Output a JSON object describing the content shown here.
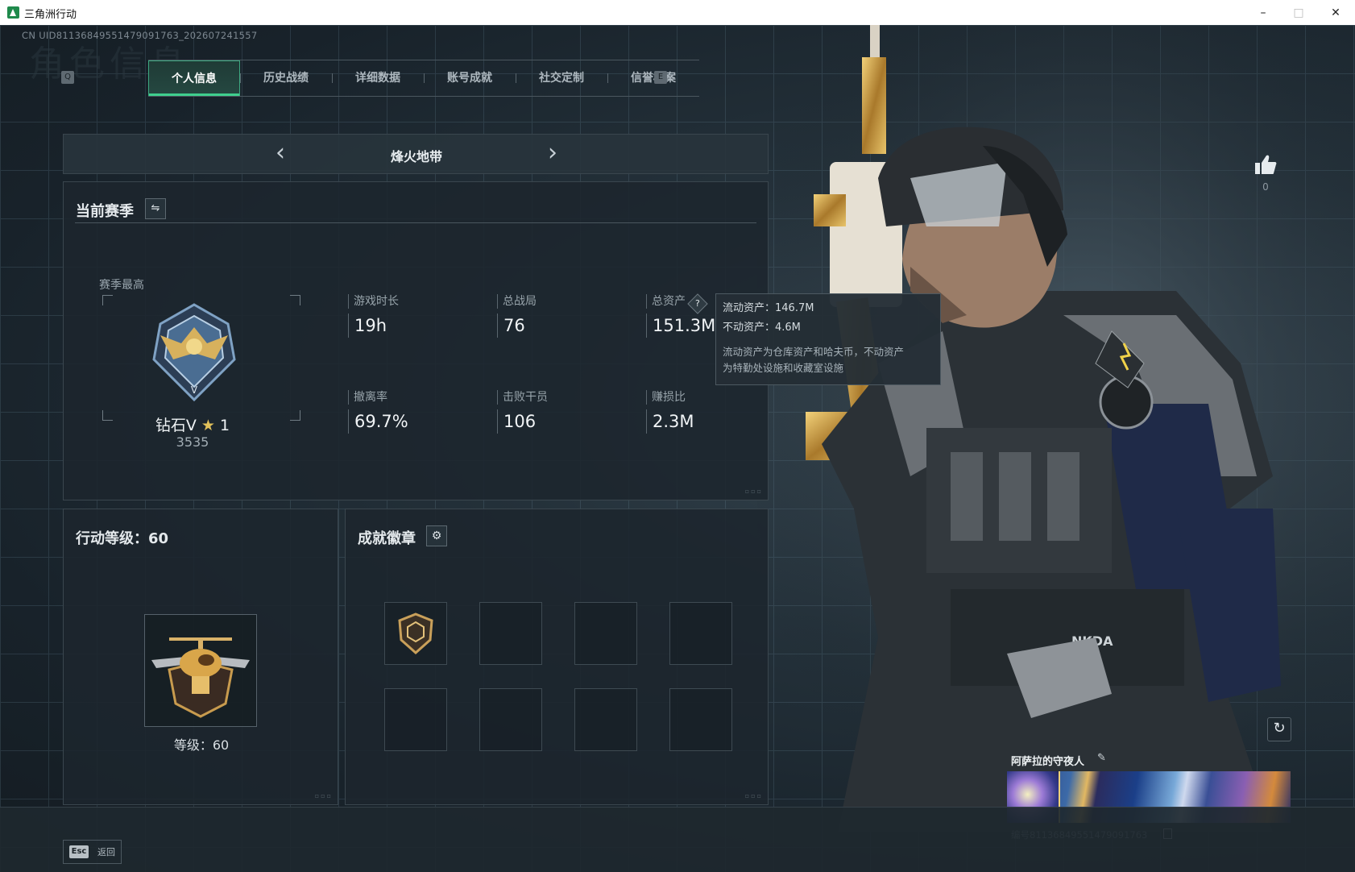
{
  "window": {
    "title": "三角洲行动",
    "min_icon": "minimize-icon",
    "max_icon": "maximize-icon",
    "close_icon": "close-icon"
  },
  "header": {
    "uid_line": "CN UID8113684955147909176​3_202607241557",
    "ghost_title": "角色信息",
    "left_key": "Q",
    "right_key": "E"
  },
  "tabs": [
    {
      "label": "个人信息",
      "active": true
    },
    {
      "label": "历史战绩"
    },
    {
      "label": "详细数据"
    },
    {
      "label": "账号成就"
    },
    {
      "label": "社交定制"
    },
    {
      "label": "信誉档案"
    }
  ],
  "mode_bar": {
    "title": "烽火地带",
    "prev_icon": "chevron-left-icon",
    "next_icon": "chevron-right-icon"
  },
  "season": {
    "title": "当前赛季",
    "swap_icon": "swap-icon",
    "best_label": "赛季最高",
    "rank_icon": "diamond-rank-emblem-icon",
    "rank_name": "钻石V",
    "rank_star_icon": "star-icon",
    "rank_stars": "1",
    "rank_score": "3535",
    "stats": [
      {
        "label": "游戏时长",
        "value": "19h"
      },
      {
        "label": "总战局",
        "value": "76"
      },
      {
        "label": "总资产",
        "value": "151.3M",
        "help": "?"
      },
      {
        "label": "撤离率",
        "value": "69.7%"
      },
      {
        "label": "击败干员",
        "value": "106"
      },
      {
        "label": "赚损比",
        "value": "2.3M"
      }
    ]
  },
  "tooltip": {
    "liquid": "流动资产：146.7M",
    "fixed": "不动资产：4.6M",
    "desc1": "流动资产为仓库资产和哈夫币，不动资产",
    "desc2": "为特勤处设施和收藏室设施"
  },
  "level": {
    "title": "行动等级：60",
    "badge_icon": "helicopter-level-badge-icon",
    "text": "等级：60"
  },
  "achievements": {
    "title": "成就徽章",
    "settings_icon": "gear-icon",
    "slot1_icon": "shield-badge-icon"
  },
  "right": {
    "like_icon": "thumbs-up-icon",
    "like_count": "0",
    "refresh_icon": "refresh-icon",
    "card_name": "阿萨拉的守夜人",
    "card_edit_icon": "pencil-icon",
    "card_id": "编号8113684955147909176​3",
    "copy_icon": "copy-icon",
    "vest_text": "NKDA"
  },
  "footer": {
    "esc_key": "Esc",
    "esc_label": "返回"
  }
}
